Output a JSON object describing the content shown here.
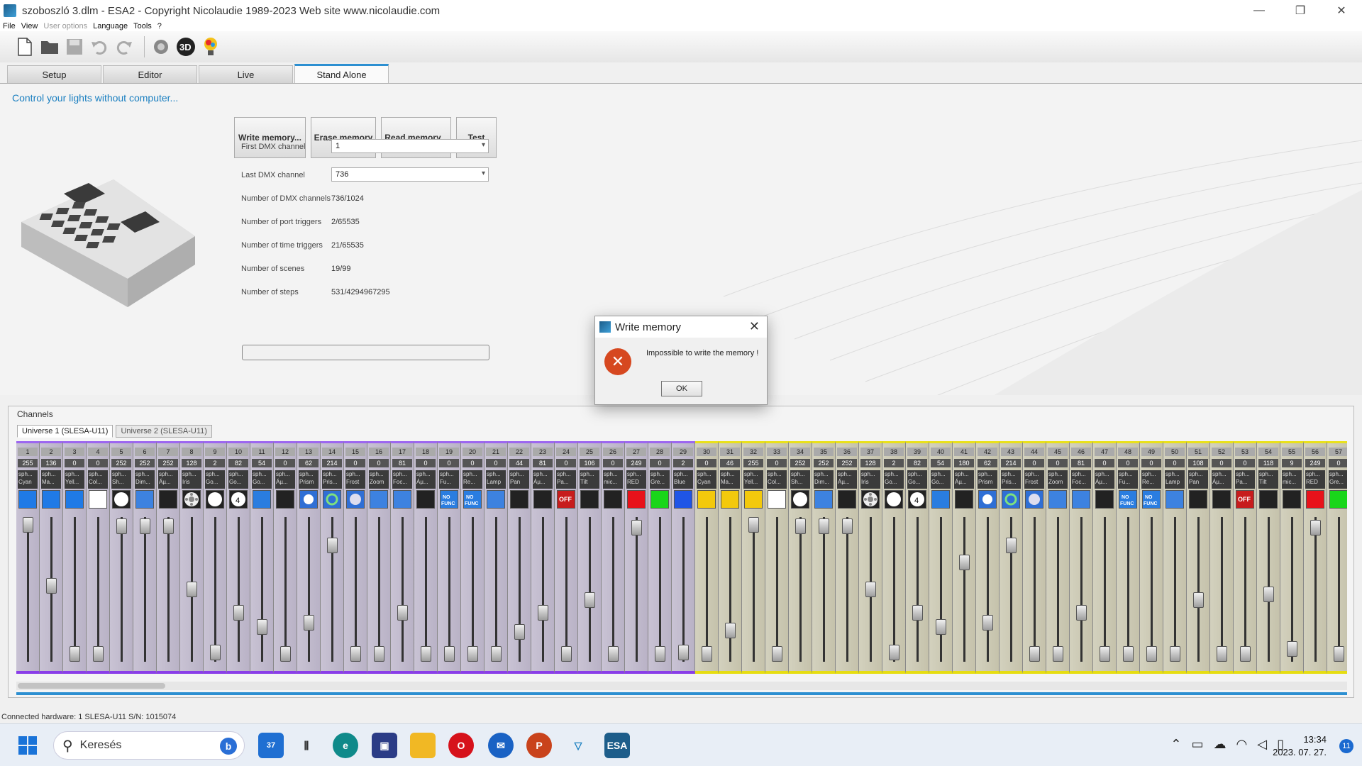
{
  "window": {
    "title": "szoboszló 3.dlm - ESA2 - Copyright Nicolaudie 1989-2023 Web site www.nicolaudie.com",
    "minimize": "—",
    "maximize": "❐",
    "close": "✕"
  },
  "menu": [
    {
      "label": "File",
      "disabled": false
    },
    {
      "label": "View",
      "disabled": false
    },
    {
      "label": "User options",
      "disabled": true
    },
    {
      "label": "Language",
      "disabled": false
    },
    {
      "label": "Tools",
      "disabled": false
    },
    {
      "label": "?",
      "disabled": false
    }
  ],
  "tabs": [
    "Setup",
    "Editor",
    "Live",
    "Stand Alone"
  ],
  "active_tab": "Stand Alone",
  "standalone": {
    "heading": "Control your lights without computer...",
    "buttons": [
      "Write memory...",
      "Erase memory",
      "Read memory...",
      "Test"
    ],
    "first_dmx_label": "First DMX channel",
    "first_dmx_value": "1",
    "last_dmx_label": "Last DMX channel",
    "last_dmx_value": "736",
    "stats": [
      {
        "label": "Number of DMX channels",
        "value": "736/1024"
      },
      {
        "label": "Number of port triggers",
        "value": "2/65535"
      },
      {
        "label": "Number of time triggers",
        "value": "21/65535"
      },
      {
        "label": "Number of scenes",
        "value": "19/99"
      },
      {
        "label": "Number of steps",
        "value": "531/4294967295"
      }
    ]
  },
  "dialog": {
    "title": "Write memory",
    "message": "Impossible to write the memory !",
    "ok_label": "OK",
    "close": "✕",
    "error_glyph": "✕"
  },
  "channels": {
    "label": "Channels",
    "universes": [
      "Universe 1 (SLESA-U11)",
      "Universe 2 (SLESA-U11)"
    ],
    "active_universe": 0,
    "list": [
      {
        "n": "1",
        "v": "255",
        "name": "sph... Cyan",
        "sw": "#1f7ae6",
        "lvl": 1.0
      },
      {
        "n": "2",
        "v": "136",
        "name": "sph... Ma...",
        "sw": "#1f7ae6",
        "lvl": 0.53
      },
      {
        "n": "3",
        "v": "0",
        "name": "sph... Yell...",
        "sw": "#1f7ae6",
        "lvl": 0
      },
      {
        "n": "4",
        "v": "0",
        "name": "sph... Col...",
        "sw": "#ffffff",
        "lvl": 0
      },
      {
        "n": "5",
        "v": "252",
        "name": "sph... Sh...",
        "sw": "circle",
        "lvl": 0.99
      },
      {
        "n": "6",
        "v": "252",
        "name": "sph... Dim...",
        "sw": "#3d82e0",
        "lvl": 0.99
      },
      {
        "n": "7",
        "v": "252",
        "name": "sph... Áµ...",
        "sw": "#222",
        "lvl": 0.99
      },
      {
        "n": "8",
        "v": "128",
        "name": "sph... Iris",
        "sw": "gobo",
        "lvl": 0.5
      },
      {
        "n": "9",
        "v": "2",
        "name": "sph... Go...",
        "sw": "circle",
        "lvl": 0.01
      },
      {
        "n": "10",
        "v": "82",
        "name": "sph... Go...",
        "sw": "gobo4",
        "lvl": 0.32
      },
      {
        "n": "11",
        "v": "54",
        "name": "sph... Go...",
        "sw": "#2a7de0",
        "lvl": 0.21
      },
      {
        "n": "12",
        "v": "0",
        "name": "sph... Áµ...",
        "sw": "#222",
        "lvl": 0
      },
      {
        "n": "13",
        "v": "62",
        "name": "sph... Prism",
        "sw": "prism",
        "lvl": 0.24
      },
      {
        "n": "14",
        "v": "214",
        "name": "sph... Pris...",
        "sw": "rot",
        "lvl": 0.84
      },
      {
        "n": "15",
        "v": "0",
        "name": "sph... Frost",
        "sw": "frost",
        "lvl": 0
      },
      {
        "n": "16",
        "v": "0",
        "name": "sph... Zoom",
        "sw": "#3d82e0",
        "lvl": 0
      },
      {
        "n": "17",
        "v": "81",
        "name": "sph... Foc...",
        "sw": "#3d82e0",
        "lvl": 0.32
      },
      {
        "n": "18",
        "v": "0",
        "name": "sph... Áµ...",
        "sw": "#222",
        "lvl": 0
      },
      {
        "n": "19",
        "v": "0",
        "name": "sph... Fu...",
        "sw": "nofunc",
        "lvl": 0
      },
      {
        "n": "20",
        "v": "0",
        "name": "sph... Re...",
        "sw": "nofunc",
        "lvl": 0
      },
      {
        "n": "21",
        "v": "0",
        "name": "sph... Lamp",
        "sw": "#3d82e0",
        "lvl": 0
      },
      {
        "n": "22",
        "v": "44",
        "name": "sph... Pan",
        "sw": "#222",
        "lvl": 0.17
      },
      {
        "n": "23",
        "v": "81",
        "name": "sph... Áµ...",
        "sw": "#222",
        "lvl": 0.32
      },
      {
        "n": "24",
        "v": "0",
        "name": "sph... Pa...",
        "sw": "off",
        "lvl": 0
      },
      {
        "n": "25",
        "v": "106",
        "name": "sph... Tilt",
        "sw": "#222",
        "lvl": 0.42
      },
      {
        "n": "26",
        "v": "0",
        "name": "sph... mic...",
        "sw": "#222",
        "lvl": 0
      },
      {
        "n": "27",
        "v": "249",
        "name": "sph... RED",
        "sw": "#e8121a",
        "lvl": 0.98
      },
      {
        "n": "28",
        "v": "0",
        "name": "sph... Gre...",
        "sw": "#19d61a",
        "lvl": 0
      },
      {
        "n": "29",
        "v": "2",
        "name": "sph... Blue",
        "sw": "#1f55e6",
        "lvl": 0.01
      },
      {
        "n": "30",
        "v": "0",
        "name": "sph... Cyan",
        "sw": "#f3c90c",
        "lvl": 0
      },
      {
        "n": "31",
        "v": "46",
        "name": "sph... Ma...",
        "sw": "#f3c90c",
        "lvl": 0.18
      },
      {
        "n": "32",
        "v": "255",
        "name": "sph... Yell...",
        "sw": "#f3c90c",
        "lvl": 1.0
      },
      {
        "n": "33",
        "v": "0",
        "name": "sph... Col...",
        "sw": "#ffffff",
        "lvl": 0
      },
      {
        "n": "34",
        "v": "252",
        "name": "sph... Sh...",
        "sw": "circle",
        "lvl": 0.99
      },
      {
        "n": "35",
        "v": "252",
        "name": "sph... Dim...",
        "sw": "#3d82e0",
        "lvl": 0.99
      },
      {
        "n": "36",
        "v": "252",
        "name": "sph... Áµ...",
        "sw": "#222",
        "lvl": 0.99
      },
      {
        "n": "37",
        "v": "128",
        "name": "sph... Iris",
        "sw": "gobo",
        "lvl": 0.5
      },
      {
        "n": "38",
        "v": "2",
        "name": "sph... Go...",
        "sw": "circle",
        "lvl": 0.01
      },
      {
        "n": "39",
        "v": "82",
        "name": "sph... Go...",
        "sw": "gobo4",
        "lvl": 0.32
      },
      {
        "n": "40",
        "v": "54",
        "name": "sph... Go...",
        "sw": "#2a7de0",
        "lvl": 0.21
      },
      {
        "n": "41",
        "v": "180",
        "name": "sph... Áµ...",
        "sw": "#222",
        "lvl": 0.71
      },
      {
        "n": "42",
        "v": "62",
        "name": "sph... Prism",
        "sw": "prism",
        "lvl": 0.24
      },
      {
        "n": "43",
        "v": "214",
        "name": "sph... Pris...",
        "sw": "rot",
        "lvl": 0.84
      },
      {
        "n": "44",
        "v": "0",
        "name": "sph... Frost",
        "sw": "frost",
        "lvl": 0
      },
      {
        "n": "45",
        "v": "0",
        "name": "sph... Zoom",
        "sw": "#3d82e0",
        "lvl": 0
      },
      {
        "n": "46",
        "v": "81",
        "name": "sph... Foc...",
        "sw": "#3d82e0",
        "lvl": 0.32
      },
      {
        "n": "47",
        "v": "0",
        "name": "sph... Áµ...",
        "sw": "#222",
        "lvl": 0
      },
      {
        "n": "48",
        "v": "0",
        "name": "sph... Fu...",
        "sw": "nofunc",
        "lvl": 0
      },
      {
        "n": "49",
        "v": "0",
        "name": "sph... Re...",
        "sw": "nofunc",
        "lvl": 0
      },
      {
        "n": "50",
        "v": "0",
        "name": "sph... Lamp",
        "sw": "#3d82e0",
        "lvl": 0
      },
      {
        "n": "51",
        "v": "108",
        "name": "sph... Pan",
        "sw": "#222",
        "lvl": 0.42
      },
      {
        "n": "52",
        "v": "0",
        "name": "sph... Áµ...",
        "sw": "#222",
        "lvl": 0
      },
      {
        "n": "53",
        "v": "0",
        "name": "sph... Pa...",
        "sw": "off",
        "lvl": 0
      },
      {
        "n": "54",
        "v": "118",
        "name": "sph... Tilt",
        "sw": "#222",
        "lvl": 0.46
      },
      {
        "n": "55",
        "v": "9",
        "name": "sph... mic...",
        "sw": "#222",
        "lvl": 0.04
      },
      {
        "n": "56",
        "v": "249",
        "name": "sph... RED",
        "sw": "#e8121a",
        "lvl": 0.98
      },
      {
        "n": "57",
        "v": "0",
        "name": "sph... Gre...",
        "sw": "#19d61a",
        "lvl": 0
      }
    ]
  },
  "statusbar": "Connected hardware: 1 SLESA-U11 S/N: 1015074",
  "taskbar": {
    "search_placeholder": "Keresés",
    "widget_badge": "37",
    "time": "13:34",
    "date": "2023. 07. 27.",
    "notif_count": "11"
  },
  "colors": {
    "accent": "#2c8fd1",
    "heading": "#1a7fc0",
    "universe1": "#8a3ee8",
    "universe2": "#e6dd12",
    "error": "#d64820"
  }
}
